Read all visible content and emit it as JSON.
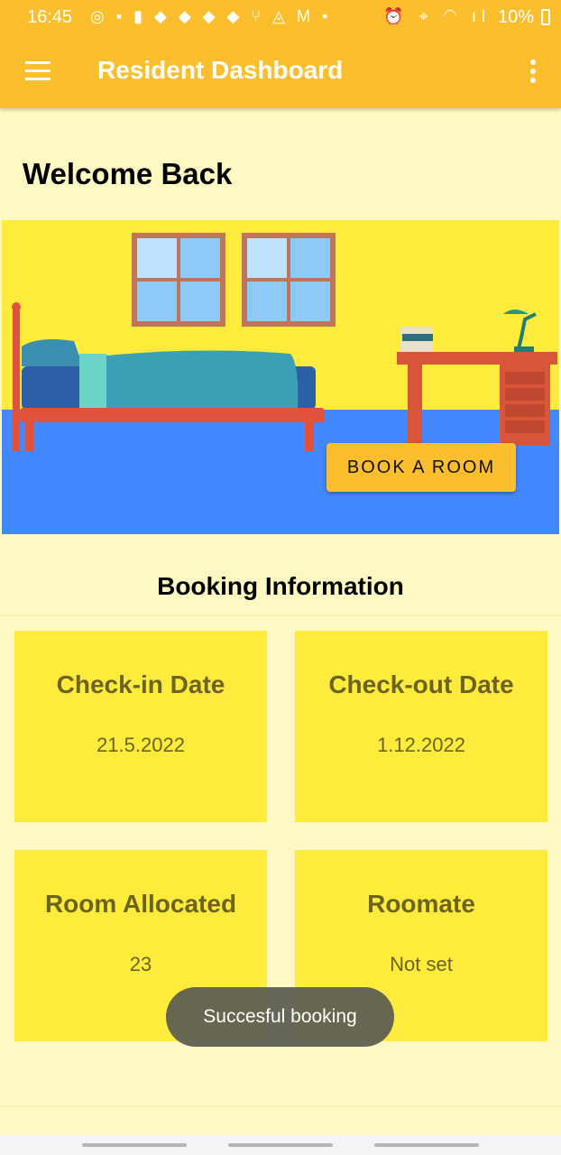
{
  "status_bar": {
    "time": "16:45",
    "left_icons": [
      "sync-icon",
      "message-icon",
      "notebook-icon",
      "snapchat-icon",
      "snapchat-icon",
      "snapchat-icon",
      "snapchat-icon",
      "restaurant-icon",
      "fire-icon",
      "gmail-icon",
      "dot-icon"
    ],
    "right_icons": [
      "alarm-icon",
      "location-icon",
      "wifi-icon",
      "signal-icon"
    ],
    "battery": "10%"
  },
  "app_bar": {
    "title": "Resident Dashboard"
  },
  "welcome": "Welcome Back",
  "hero": {
    "button_label": "BOOK A ROOM"
  },
  "booking": {
    "title": "Booking Information",
    "cards": [
      {
        "label": "Check-in Date",
        "value": "21.5.2022"
      },
      {
        "label": "Check-out Date",
        "value": "1.12.2022"
      },
      {
        "label": "Room Allocated",
        "value": "23"
      },
      {
        "label": "Roomate",
        "value": "Not set"
      }
    ]
  },
  "toast": "Succesful booking",
  "colors": {
    "accent": "#fbbf2d",
    "background": "#fef9c3",
    "card": "#ffeb3b",
    "card_text": "#6b6420",
    "floor": "#4488ff"
  }
}
